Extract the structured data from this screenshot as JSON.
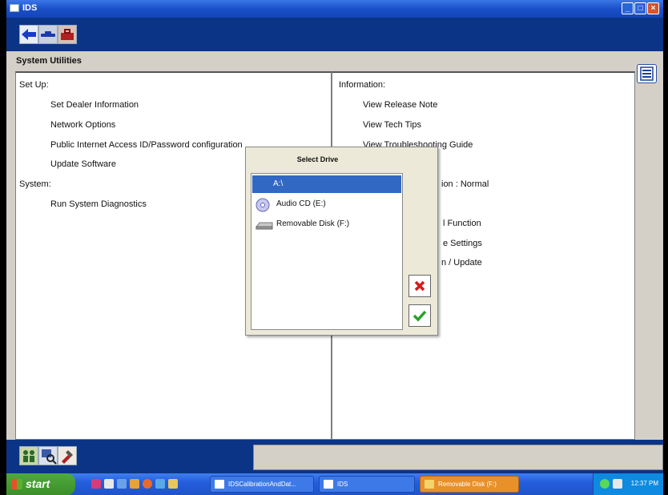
{
  "window": {
    "title": "IDS"
  },
  "toolbar": {
    "back_icon": "arrow-left-icon",
    "vehicle_icon": "car-icon",
    "tools_icon": "toolbox-icon"
  },
  "section_title": "System Utilities",
  "left_panel": {
    "setup_heading": "Set Up:",
    "setup_items": [
      "Set Dealer Information",
      "Network Options",
      "Public Internet Access ID/Password configuration",
      "Update Software"
    ],
    "system_heading": "System:",
    "system_items": [
      "Run System Diagnostics"
    ]
  },
  "right_panel": {
    "heading": "Information:",
    "items": [
      "View Release Note",
      "View Tech Tips",
      "View Troubleshooting Guide"
    ],
    "partial_items": [
      "ion : Normal",
      "l Function",
      "e Settings",
      "n / Update"
    ]
  },
  "dialog": {
    "title": "Select Drive",
    "drives": [
      {
        "label": "A:\\",
        "icon": "floppy-icon",
        "selected": true
      },
      {
        "label": "Audio CD (E:)",
        "icon": "cd-icon",
        "selected": false
      },
      {
        "label": "Removable Disk (F:)",
        "icon": "removable-disk-icon",
        "selected": false
      }
    ],
    "cancel_icon": "red-x-icon",
    "ok_icon": "green-check-icon"
  },
  "bottom_toolbar": {
    "icons": [
      "people-icon",
      "search-computer-icon",
      "tools-icon"
    ]
  },
  "taskbar": {
    "start_label": "start",
    "tasks": [
      {
        "label": "IDSCalibrationAndDat...",
        "active": false
      },
      {
        "label": "IDS",
        "active": false
      },
      {
        "label": "Removable Disk (F:)",
        "active": true
      }
    ],
    "clock": "12:37 PM"
  },
  "colors": {
    "toolbar_blue": "#0b3486",
    "selection_blue": "#3168c4",
    "xp_title_blue": "#245edc",
    "start_green": "#3c8f2a"
  }
}
